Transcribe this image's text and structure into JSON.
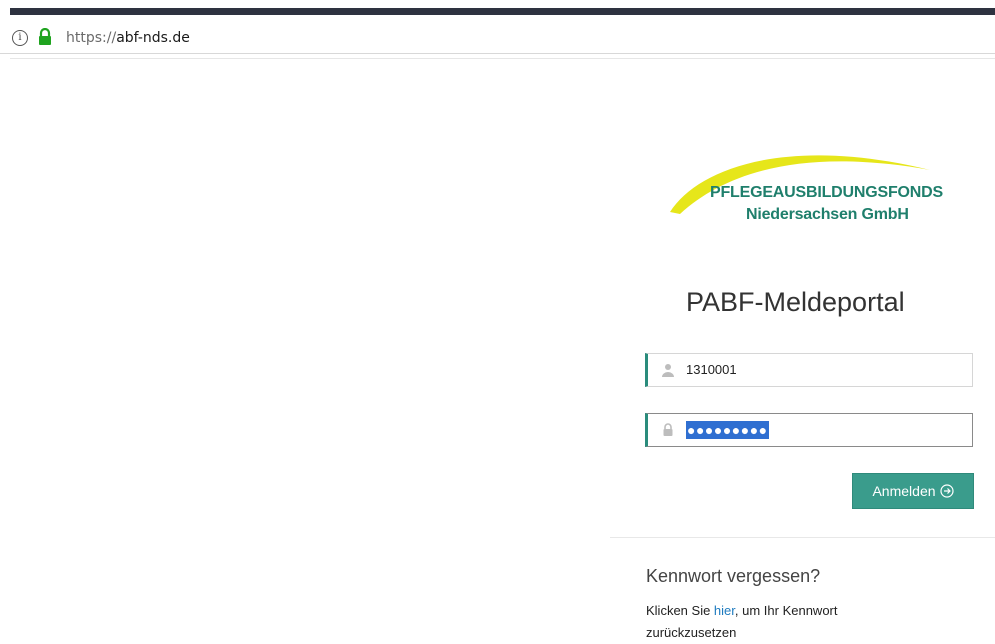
{
  "browser": {
    "url_protocol": "https://",
    "url_host": "abf-nds.de",
    "info_icon": "info-icon",
    "lock_icon": "lock-icon"
  },
  "logo": {
    "line1": "PFLEGEAUSBILDUNGSFONDS",
    "line2": "Niedersachsen GmbH",
    "colors": {
      "swoosh": "#e6e61a",
      "text": "#1f7f6c"
    }
  },
  "login": {
    "title": "PABF-Meldeportal",
    "username_value": "1310001",
    "password_masked": "●●●●●●●●●",
    "submit_label": "Anmelden",
    "accent_color": "#3a9c8c"
  },
  "forgot": {
    "title": "Kennwort vergessen?",
    "text_before": "Klicken Sie ",
    "link_text": "hier",
    "text_after": ", um Ihr Kennwort zurückzusetzen"
  }
}
